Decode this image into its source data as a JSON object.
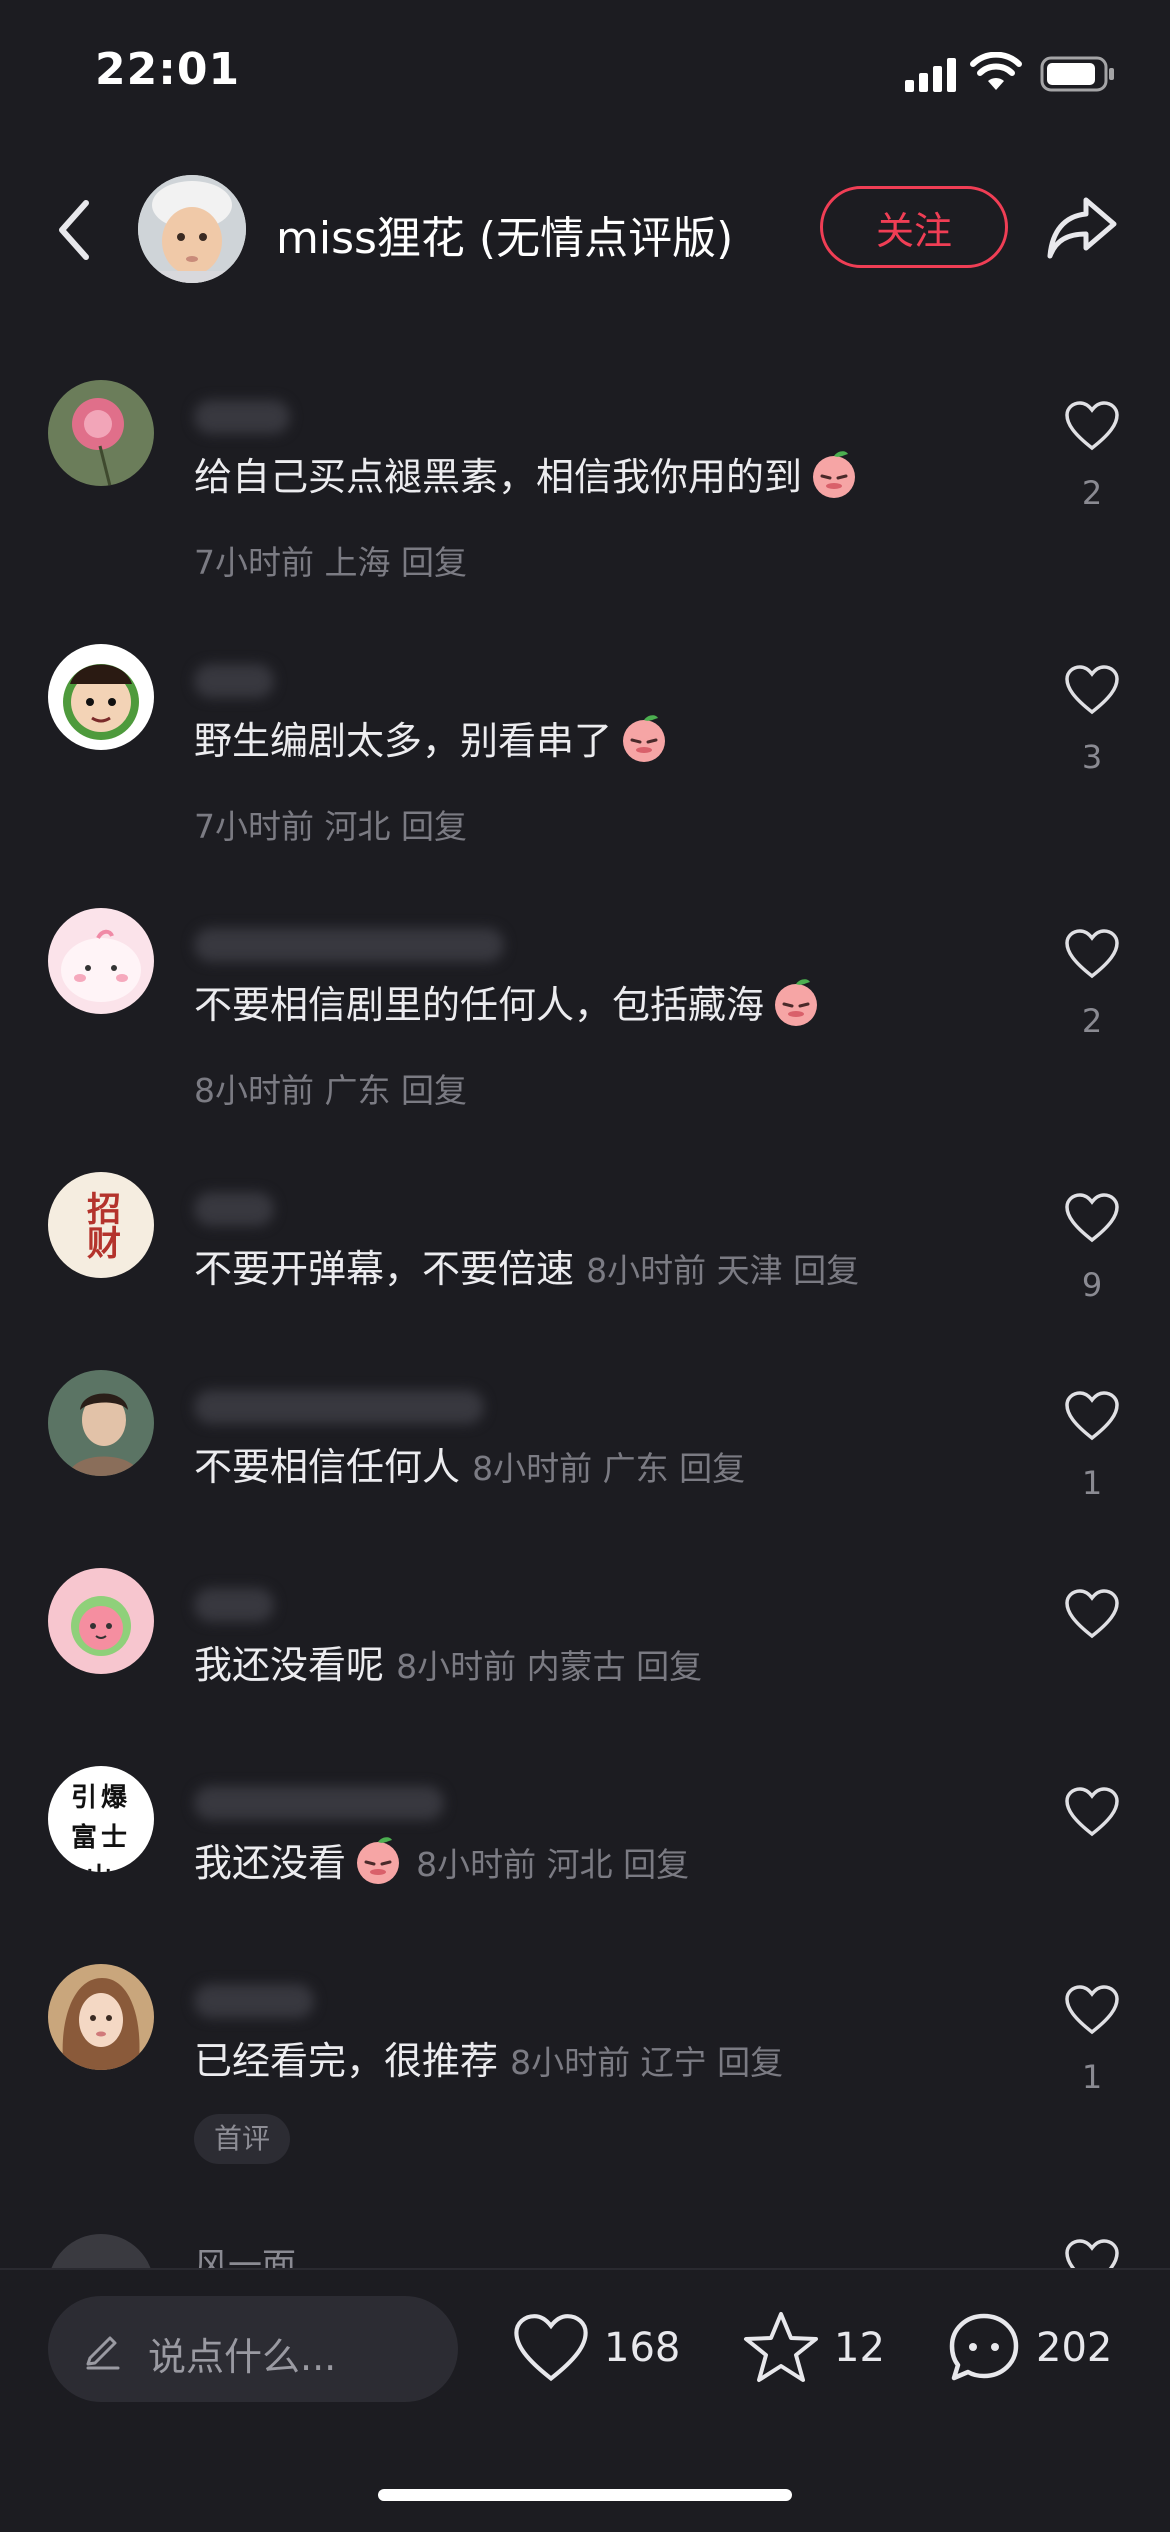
{
  "status_bar": {
    "time": "22:01",
    "icons": [
      "signal-icon",
      "wifi-icon",
      "battery-icon"
    ]
  },
  "header": {
    "author_name": "miss狸花 (无情点评版)",
    "follow_label": "关注"
  },
  "comments": [
    {
      "text": "给自己买点褪黑素，相信我你用的到",
      "emoji": true,
      "meta": "7小时前 上海 回复",
      "likes": "2",
      "meta_inline": false
    },
    {
      "text": "野生编剧太多，别看串了",
      "emoji": true,
      "meta": "7小时前 河北 回复",
      "likes": "3",
      "meta_inline": false
    },
    {
      "text": "不要相信剧里的任何人，包括藏海",
      "emoji": true,
      "meta": "8小时前 广东 回复",
      "likes": "2",
      "meta_inline": false
    },
    {
      "text": "不要开弹幕，不要倍速",
      "emoji": false,
      "meta": "8小时前 天津 回复",
      "likes": "9",
      "meta_inline": true
    },
    {
      "text": "不要相信任何人",
      "emoji": false,
      "meta": "8小时前 广东 回复",
      "likes": "1",
      "meta_inline": true
    },
    {
      "text": "我还没看呢",
      "emoji": false,
      "meta": "8小时前 内蒙古 回复",
      "likes": "",
      "meta_inline": true
    },
    {
      "text": "我还没看",
      "emoji": true,
      "meta": "8小时前 河北 回复",
      "likes": "",
      "meta_inline": true
    },
    {
      "text": "已经看完，很推荐",
      "emoji": false,
      "meta": "8小时前 辽宁 回复",
      "likes": "1",
      "meta_inline": true,
      "tag": "首评"
    }
  ],
  "partial_comment_user": "风一面",
  "avatar4_text": "招财",
  "avatar7_text": "引爆富士山",
  "bottom_bar": {
    "input_placeholder": "说点什么...",
    "likes": "168",
    "favorites": "12",
    "comments": "202"
  },
  "colors": {
    "background": "#1c1c21",
    "accent": "#f03e55",
    "meta": "#7b7b83"
  }
}
